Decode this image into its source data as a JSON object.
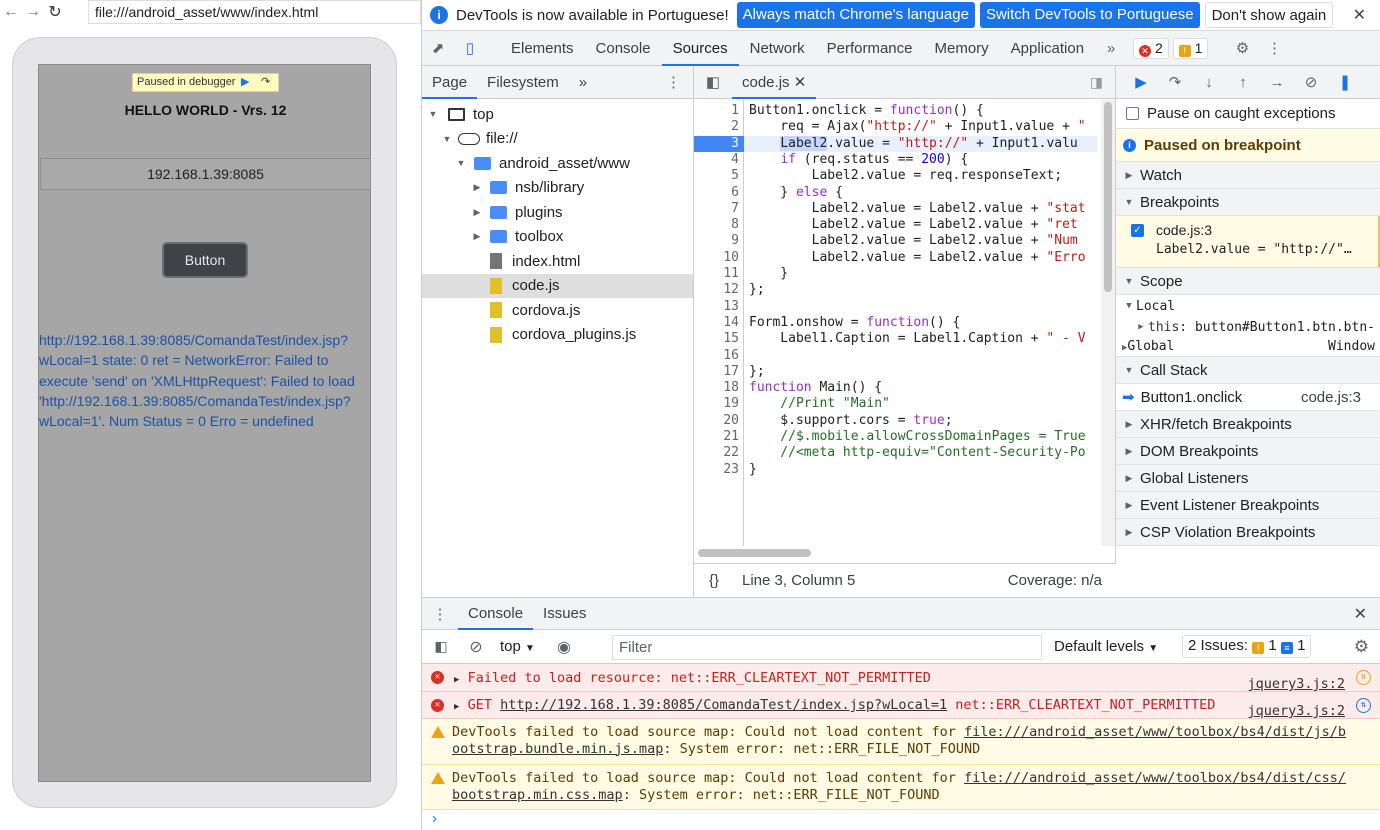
{
  "browser": {
    "url": "file:///android_asset/www/index.html"
  },
  "app": {
    "paused_label": "Paused in debugger",
    "title": "HELLO WORLD - Vrs. 12",
    "ip_value": "192.168.1.39:8085",
    "button_label": "Button",
    "error_text": "http://192.168.1.39:8085/ComandaTest/index.jsp?wLocal=1 state: 0 ret = NetworkError: Failed to execute 'send' on 'XMLHttpRequest': Failed to load 'http://192.168.1.39:8085/ComandaTest/index.jsp?wLocal=1'. Num Status = 0 Erro = undefined"
  },
  "infobar": {
    "message": "DevTools is now available in Portuguese!",
    "btn_match": "Always match Chrome's language",
    "btn_switch": "Switch DevTools to Portuguese",
    "btn_dont": "Don't show again"
  },
  "tabs": [
    "Elements",
    "Console",
    "Sources",
    "Network",
    "Performance",
    "Memory",
    "Application"
  ],
  "active_tab": "Sources",
  "badges": {
    "errors": "2",
    "warnings": "1"
  },
  "navigator": {
    "tabs": [
      "Page",
      "Filesystem"
    ],
    "tree": [
      "top",
      "file://",
      "android_asset/www",
      "nsb/library",
      "plugins",
      "toolbox",
      "index.html",
      "code.js",
      "cordova.js",
      "cordova_plugins.js"
    ]
  },
  "editor": {
    "tab": "code.js",
    "status_pos": "Line 3, Column 5",
    "status_cov": "Coverage: n/a"
  },
  "debugger": {
    "pause_caught": "Pause on caught exceptions",
    "paused_msg": "Paused on breakpoint",
    "watch": "Watch",
    "breakpoints": "Breakpoints",
    "bp_file": "code.js:3",
    "bp_code": "Label2.value = \"http://\"…",
    "scope": "Scope",
    "local": "Local",
    "this_label": "this:",
    "this_value": "button#Button1.btn.btn-",
    "global": "Global",
    "global_value": "Window",
    "call_stack": "Call Stack",
    "frame_fn": "Button1.onclick",
    "frame_loc": "code.js:3",
    "sections": [
      "XHR/fetch Breakpoints",
      "DOM Breakpoints",
      "Global Listeners",
      "Event Listener Breakpoints",
      "CSP Violation Breakpoints"
    ]
  },
  "console": {
    "tabs": [
      "Console",
      "Issues"
    ],
    "context": "top",
    "filter_placeholder": "Filter",
    "levels": "Default levels",
    "issues_label": "2 Issues:",
    "issues_warn": "1",
    "issues_info": "1",
    "messages": [
      {
        "text": "Failed to load resource: net::ERR_CLEARTEXT_NOT_PERMITTED",
        "src": "jquery3.js:2"
      },
      {
        "prefix": "GET ",
        "link": "http://192.168.1.39:8085/ComandaTest/index.jsp?wLocal=1",
        "suffix": " net::ERR_CLEARTEXT_NOT_PERMITTED",
        "src": "jquery3.js:2"
      },
      {
        "pre": "DevTools failed to load source map: Could not load content for ",
        "link1": "file:///android_asset/www/toolbox/bs4/dist/js/b",
        "link2": "ootstrap.bundle.min.js.map",
        "post": ": System error: net::ERR_FILE_NOT_FOUND"
      },
      {
        "pre": "DevTools failed to load source map: Could not load content for ",
        "link1": "file:///android_asset/www/toolbox/bs4/dist/css/",
        "link2": "bootstrap.min.css.map",
        "post": ": System error: net::ERR_FILE_NOT_FOUND"
      }
    ]
  },
  "code_lines": [
    "Button1.onclick = function() {",
    "    req = Ajax(\"http://\" + Input1.value + \"",
    "    Label2.value = \"http://\" + Input1.valu",
    "    if (req.status == 200) {",
    "        Label2.value = req.responseText;",
    "    } else {",
    "        Label2.value = Label2.value + \"stat",
    "        Label2.value = Label2.value + \"ret ",
    "        Label2.value = Label2.value + \"Num ",
    "        Label2.value = Label2.value + \"Erro",
    "    }",
    "};",
    "",
    "Form1.onshow = function() {",
    "    Label1.Caption = Label1.Caption + \" - V",
    "",
    "};",
    "function Main() {",
    "    //Print \"Main\"",
    "    $.support.cors = true;",
    "    //$.mobile.allowCrossDomainPages = True",
    "    //<meta http-equiv=\"Content-Security-Po",
    "}"
  ]
}
